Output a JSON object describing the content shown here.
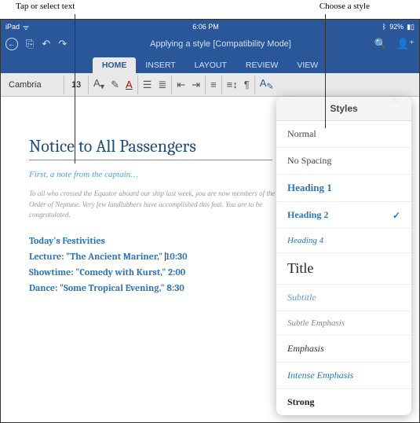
{
  "annotations": {
    "left": "Tap or select text",
    "right": "Choose a style"
  },
  "statusbar": {
    "device": "iPad",
    "wifi": "᯾",
    "time": "6:06 PM",
    "bt": "92%"
  },
  "titlebar": {
    "doc_title": "Applying a style [Compatibility Mode]"
  },
  "tabs": {
    "items": [
      {
        "label": "HOME",
        "selected": true
      },
      {
        "label": "INSERT"
      },
      {
        "label": "LAYOUT"
      },
      {
        "label": "REVIEW"
      },
      {
        "label": "VIEW"
      }
    ]
  },
  "ribbon": {
    "font_name": "Cambria",
    "font_size": "13"
  },
  "document": {
    "title": "Notice to All Passengers",
    "subtitle": "First, a note from the captain…",
    "para": "To all who crossed the Equator aboard our ship last week, you are now members of the Order of Neptune. Very few landlubbers have accomplished this feat. You are to be congratulated.",
    "section": "Today's Festivities",
    "line1a": "Lecture: \"The Ancient Mariner,\" ",
    "line1b": "10:30",
    "line2": "Showtime: \"Comedy with Kurst,\" 2:00",
    "line3": "Dance: \"Some Tropical Evening,\" 8:30"
  },
  "styles_popup": {
    "header": "Styles",
    "items": [
      {
        "label": "Normal",
        "cls": "pi-normal"
      },
      {
        "label": "No Spacing",
        "cls": "pi-nospacing"
      },
      {
        "label": "Heading 1",
        "cls": "pi-h1"
      },
      {
        "label": "Heading 2",
        "cls": "pi-h2",
        "checked": true
      },
      {
        "label": "Heading 4",
        "cls": "pi-h4"
      },
      {
        "label": "Title",
        "cls": "pi-title"
      },
      {
        "label": "Subtitle",
        "cls": "pi-subtitle"
      },
      {
        "label": "Subtle Emphasis",
        "cls": "pi-subtleem"
      },
      {
        "label": "Emphasis",
        "cls": "pi-em"
      },
      {
        "label": "Intense Emphasis",
        "cls": "pi-intenseem"
      },
      {
        "label": "Strong",
        "cls": "pi-strong"
      }
    ]
  }
}
